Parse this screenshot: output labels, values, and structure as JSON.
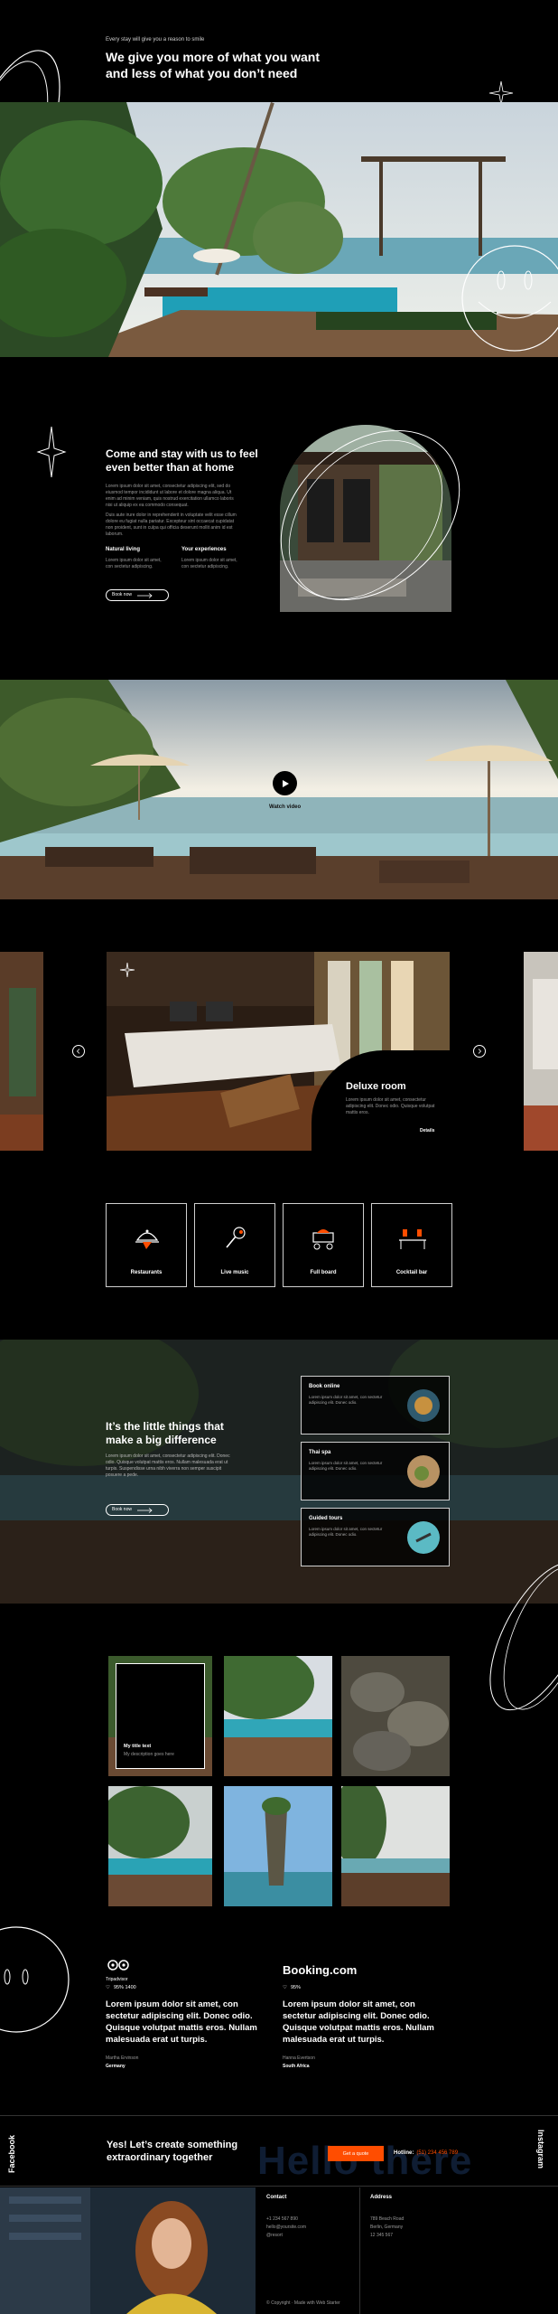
{
  "hero": {
    "eyebrow": "Every stay will give you a reason to smile",
    "title_line1": "We give you more of what you want",
    "title_line2": "and less of what you don’t need"
  },
  "intro": {
    "title_line1": "Come and stay with us to feel",
    "title_line2": "even better than at home",
    "body1": "Lorem ipsum dolor sit amet, consectetur adipiscing elit, sed do eiusmod tempor incididunt ut labore et dolore magna aliqua. Ut enim ad minim veniam, quis nostrud exercitation ullamco laboris nisi ut aliquip ex ea commodo consequat.",
    "body2": "Duis aute irure dolor in reprehenderit in voluptate velit esse cillum dolore eu fugiat nulla pariatur. Excepteur sint occaecat cupidatat non proident, sunt in culpa qui officia deserunt mollit anim id est laborum.",
    "col1_title": "Natural living",
    "col1_text": "Lorem ipsum dolor sit amet, con sectetur adipiscing.",
    "col2_title": "Your experiences",
    "col2_text": "Lorem ipsum dolor sit amet, con sectetur adipiscing.",
    "button": "Book now"
  },
  "video": {
    "label": "Watch video"
  },
  "room": {
    "title": "Deluxe room",
    "text": "Lorem ipsum dolor sit amet, consectetur adipiscing elit. Donec odio. Quisque volutpat mattis eros.",
    "link": "Details"
  },
  "amenities": [
    {
      "label": "Restaurants",
      "icon": "cloche-icon"
    },
    {
      "label": "Live music",
      "icon": "microphone-icon"
    },
    {
      "label": "Full board",
      "icon": "food-cart-icon"
    },
    {
      "label": "Cocktail bar",
      "icon": "cocktail-bar-icon"
    }
  ],
  "little": {
    "title_line1": "It’s the little things that",
    "title_line2": "make a big difference",
    "body": "Lorem ipsum dolor sit amet, consectetur adipiscing elit. Donec odio. Quisque volutpat mattis eros. Nullam malesuada erat ut turpis. Suspendisse urna nibh viverra non semper suscipit posuere a pede.",
    "button": "Book now",
    "cards": [
      {
        "title": "Book online",
        "text": "Lorem ipsum dolor sit amet, con sectetur adipiscing elit. Donec odio."
      },
      {
        "title": "Thai spa",
        "text": "Lorem ipsum dolor sit amet, con sectetur adipiscing elit. Donec odio."
      },
      {
        "title": "Guided tours",
        "text": "Lorem ipsum dolor sit amet, con sectetur adipiscing elit. Donec odio."
      }
    ]
  },
  "gallery": {
    "overlay_title": "My title text",
    "overlay_sub": "My description goes here"
  },
  "reviews": [
    {
      "brand": "Tripadvisor",
      "stats": "95%   1400",
      "quote": "Lorem ipsum dolor sit amet, con sectetur adipiscing elit. Donec odio. Quisque volutpat mattis eros. Nullam malesuada erat ut turpis.",
      "author": "Martha Ervinson",
      "country": "Germany"
    },
    {
      "brand": "Booking.com",
      "stats": "95%",
      "quote": "Lorem ipsum dolor sit amet, con sectetur adipiscing elit. Donec odio. Quisque volutpat mattis eros. Nullam malesuada erat ut turpis.",
      "author": "Hanna Evertson",
      "country": "South Africa"
    }
  ],
  "cta": {
    "title_line1": "Yes! Let’s create something",
    "title_line2": "extraordinary together",
    "button": "Get a quote",
    "hotline_label": "Hotline:",
    "hotline_number": "(51) 234 456 789",
    "watermark": "Hello there",
    "left_vertical": "Facebook",
    "right_vertical": "Instagram"
  },
  "footer": {
    "contact_title": "Contact",
    "contact_lines": [
      "+1 234 567 890",
      "hello@yoursite.com",
      "@resort"
    ],
    "address_title": "Address",
    "address_lines": [
      "789 Beach Road",
      "Berlin, Germany",
      "12 345 567"
    ],
    "copyright": "© Copyright · Made with Web Starter"
  },
  "colors": {
    "accent": "#ff4d00",
    "background": "#000000",
    "card_border": "#cfcfcf"
  }
}
